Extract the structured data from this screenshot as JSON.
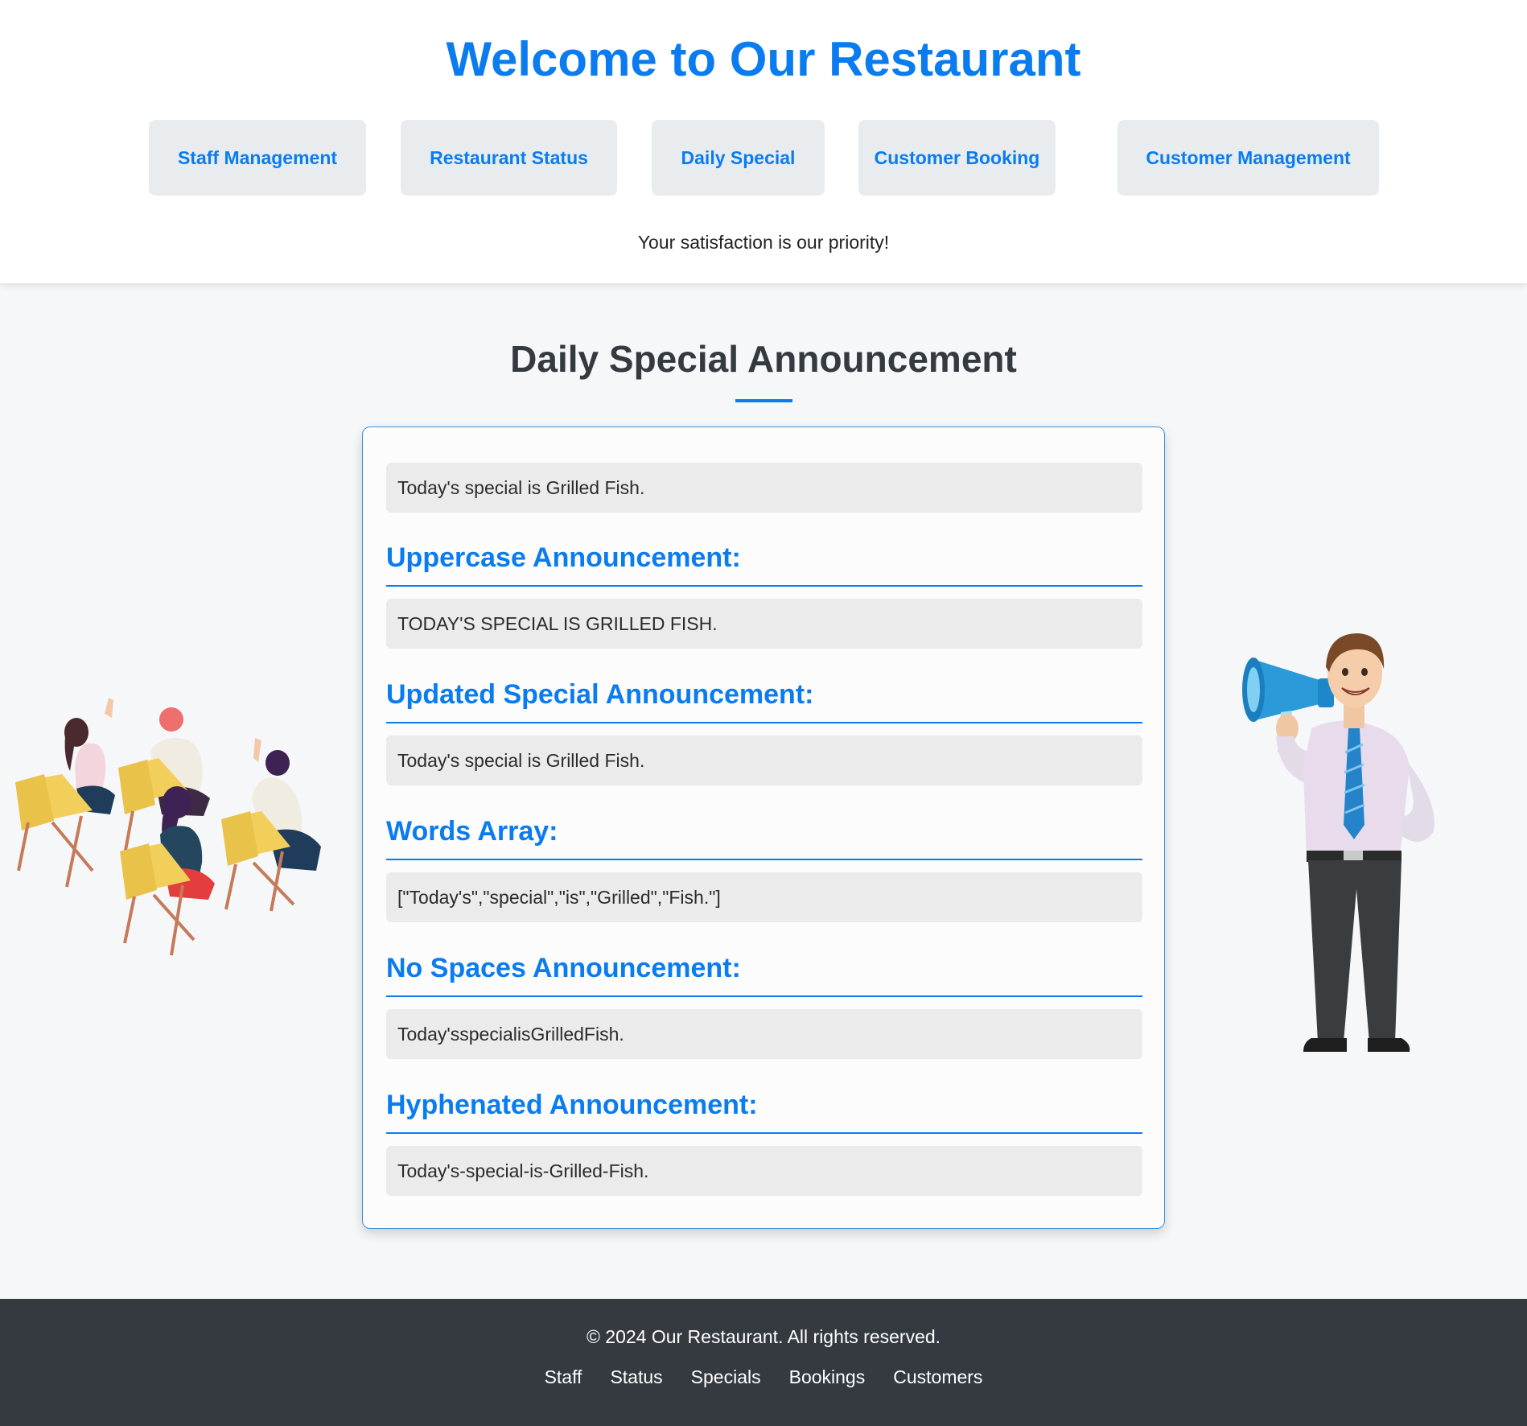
{
  "header": {
    "title": "Welcome to Our Restaurant",
    "tagline": "Your satisfaction is our priority!",
    "nav": [
      {
        "label": "Staff Management"
      },
      {
        "label": "Restaurant Status"
      },
      {
        "label": "Daily Special"
      },
      {
        "label": "Customer Booking"
      },
      {
        "label": "Customer Management"
      }
    ]
  },
  "main": {
    "title": "Daily Special Announcement",
    "original": "Today's special is Grilled Fish.",
    "sections": [
      {
        "heading": "Uppercase Announcement:",
        "value": "TODAY'S SPECIAL IS GRILLED FISH."
      },
      {
        "heading": "Updated Special Announcement:",
        "value": "Today's special is Grilled Fish."
      },
      {
        "heading": "Words Array:",
        "value": "[\"Today's\",\"special\",\"is\",\"Grilled\",\"Fish.\"]"
      },
      {
        "heading": "No Spaces Announcement:",
        "value": "Today'sspecialisGrilledFish."
      },
      {
        "heading": "Hyphenated Announcement:",
        "value": "Today's-special-is-Grilled-Fish."
      }
    ]
  },
  "illustrations": {
    "left": "audience-illustration",
    "right": "announcer-megaphone-illustration"
  },
  "footer": {
    "copyright": "© 2024 Our Restaurant. All rights reserved.",
    "links": [
      {
        "label": "Staff"
      },
      {
        "label": "Status"
      },
      {
        "label": "Specials"
      },
      {
        "label": "Bookings"
      },
      {
        "label": "Customers"
      }
    ]
  },
  "colors": {
    "accent": "#0a7cf0",
    "footer_bg": "#343a40",
    "nav_bg": "#e9ecef",
    "page_bg": "#f5f7f9"
  }
}
